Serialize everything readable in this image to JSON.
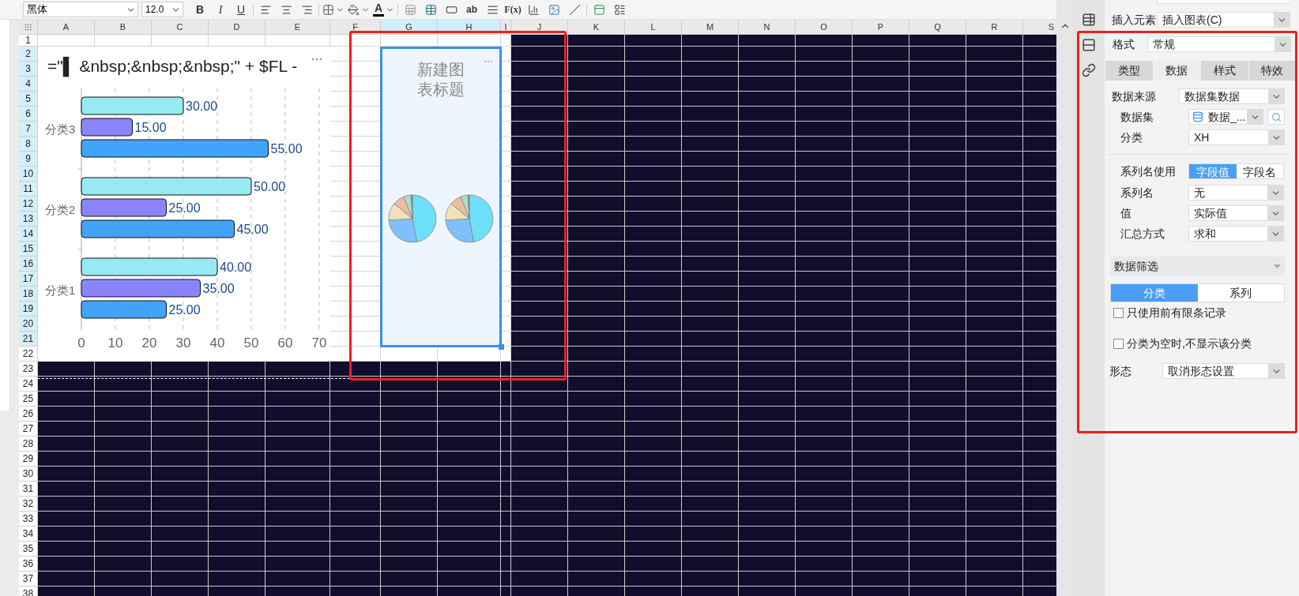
{
  "toolbar": {
    "font": "黑体",
    "size": "12.0",
    "format_buttons": [
      "B",
      "I",
      "U"
    ],
    "font_color": "A",
    "insert_text": "ab",
    "formula": "F(x)"
  },
  "sheet": {
    "columns": [
      {
        "label": "A",
        "selected": false
      },
      {
        "label": "B",
        "selected": false
      },
      {
        "label": "C",
        "selected": false
      },
      {
        "label": "D",
        "selected": false
      },
      {
        "label": "E",
        "selected": false
      },
      {
        "label": "F",
        "selected": false
      },
      {
        "label": "G",
        "selected": true
      },
      {
        "label": "H",
        "selected": true
      },
      {
        "label": "I",
        "selected": false
      },
      {
        "label": "J",
        "selected": false
      },
      {
        "label": "K",
        "selected": false
      },
      {
        "label": "L",
        "selected": false
      },
      {
        "label": "M",
        "selected": false
      },
      {
        "label": "N",
        "selected": false
      },
      {
        "label": "O",
        "selected": false
      },
      {
        "label": "P",
        "selected": false
      },
      {
        "label": "Q",
        "selected": false
      },
      {
        "label": "R",
        "selected": false
      },
      {
        "label": "S",
        "selected": false
      }
    ],
    "rows": [
      {
        "label": "1",
        "selected": false
      },
      {
        "label": "2",
        "selected": true
      },
      {
        "label": "3",
        "selected": true
      },
      {
        "label": "4",
        "selected": true
      },
      {
        "label": "5",
        "selected": true
      },
      {
        "label": "6",
        "selected": true
      },
      {
        "label": "7",
        "selected": true
      },
      {
        "label": "8",
        "selected": true
      },
      {
        "label": "9",
        "selected": true
      },
      {
        "label": "10",
        "selected": true
      },
      {
        "label": "11",
        "selected": true
      },
      {
        "label": "12",
        "selected": true
      },
      {
        "label": "13",
        "selected": true
      },
      {
        "label": "14",
        "selected": true
      },
      {
        "label": "15",
        "selected": true
      },
      {
        "label": "16",
        "selected": true
      },
      {
        "label": "17",
        "selected": true
      },
      {
        "label": "18",
        "selected": true
      },
      {
        "label": "19",
        "selected": true
      },
      {
        "label": "20",
        "selected": true
      },
      {
        "label": "21",
        "selected": true
      },
      {
        "label": "22",
        "selected": false
      },
      {
        "label": "23",
        "selected": false
      },
      {
        "label": "24",
        "selected": false
      },
      {
        "label": "25",
        "selected": false
      },
      {
        "label": "26",
        "selected": false
      },
      {
        "label": "27",
        "selected": false
      },
      {
        "label": "28",
        "selected": false
      },
      {
        "label": "29",
        "selected": false
      },
      {
        "label": "30",
        "selected": false
      },
      {
        "label": "31",
        "selected": false
      },
      {
        "label": "32",
        "selected": false
      },
      {
        "label": "33",
        "selected": false
      },
      {
        "label": "34",
        "selected": false
      },
      {
        "label": "35",
        "selected": false
      },
      {
        "label": "36",
        "selected": false
      },
      {
        "label": "37",
        "selected": false
      },
      {
        "label": "38",
        "selected": false
      }
    ]
  },
  "bar_chart": {
    "title": "=\"▌ &nbsp;&nbsp;&nbsp;\" + $FL -",
    "chart_data": {
      "type": "bar",
      "orientation": "horizontal",
      "categories": [
        "分类3",
        "分类2",
        "分类1"
      ],
      "series": [
        {
          "color": "#97eaf2",
          "values": [
            30,
            50,
            40
          ],
          "value_labels": [
            "30.00",
            "50.00",
            "40.00"
          ]
        },
        {
          "color": "#8a84fb",
          "values": [
            15,
            25,
            35
          ],
          "value_labels": [
            "15.00",
            "25.00",
            "35.00"
          ]
        },
        {
          "color": "#42a3fb",
          "values": [
            55,
            45,
            25
          ],
          "value_labels": [
            "55.00",
            "45.00",
            "25.00"
          ]
        }
      ],
      "xlim": [
        0,
        70
      ],
      "xticks": [
        0,
        10,
        20,
        30,
        40,
        50,
        60,
        70
      ],
      "grid": true
    }
  },
  "pie_chart": {
    "title": "新建图表标题",
    "selected": true
  },
  "side_panel": {
    "insert_element": {
      "label": "插入元素",
      "value": "插入图表(C)"
    },
    "format": {
      "label": "格式",
      "value": "常规"
    },
    "tabs": [
      {
        "label": "类型",
        "selected": false
      },
      {
        "label": "数据",
        "selected": true
      },
      {
        "label": "样式",
        "selected": false
      },
      {
        "label": "特效",
        "selected": false
      }
    ],
    "data_source": {
      "label": "数据来源",
      "value": "数据集数据"
    },
    "dataset": {
      "label": "数据集",
      "value": "数据_..."
    },
    "category": {
      "label": "分类",
      "value": "XH"
    },
    "series_name_use": {
      "label": "系列名使用",
      "options": [
        {
          "label": "字段值",
          "selected": true
        },
        {
          "label": "字段名",
          "selected": false
        }
      ]
    },
    "fields": [
      {
        "label": "系列名",
        "value": "无"
      },
      {
        "label": "值",
        "value": "实际值"
      },
      {
        "label": "汇总方式",
        "value": "求和"
      }
    ],
    "filter": {
      "title": "数据筛选",
      "tabs": [
        {
          "label": "分类",
          "selected": true
        },
        {
          "label": "系列",
          "selected": false
        }
      ],
      "checkboxes": [
        {
          "label": "只使用前有限条记录",
          "checked": false
        },
        {
          "label": "分类为空时,不显示该分类",
          "checked": false
        }
      ]
    },
    "shape": {
      "label": "形态",
      "value": "取消形态设置"
    }
  }
}
